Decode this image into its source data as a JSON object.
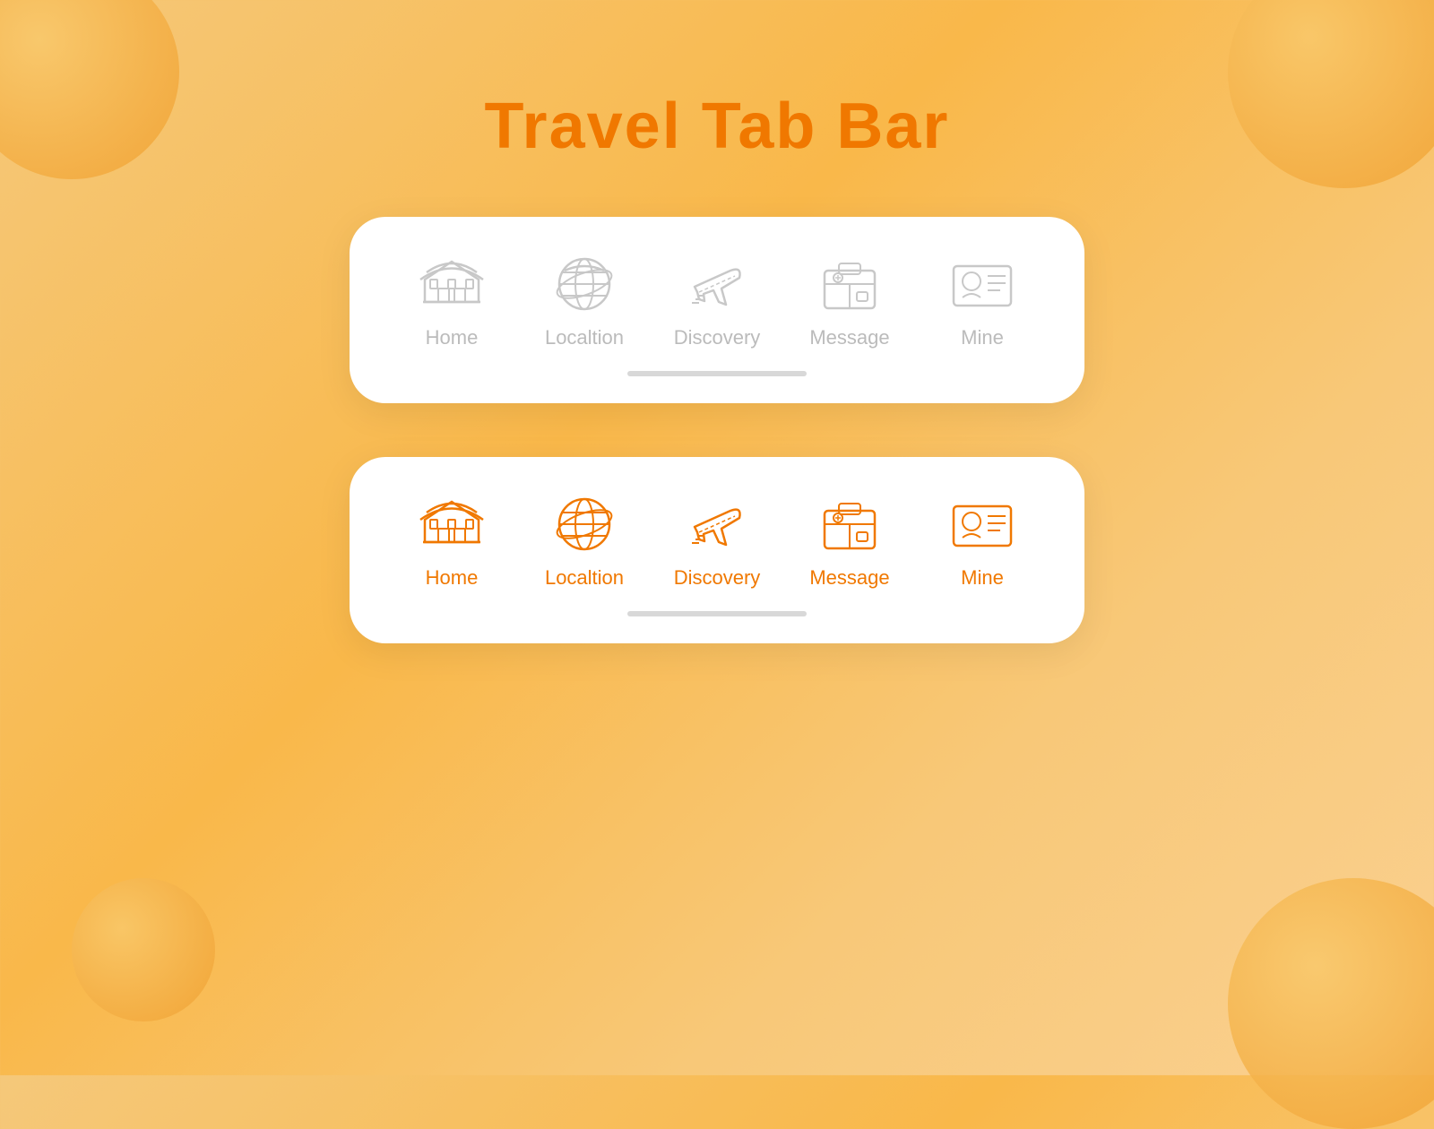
{
  "page": {
    "title": "Travel Tab Bar",
    "title_color": "#f07800"
  },
  "tab_bars": [
    {
      "id": "inactive",
      "style": "inactive",
      "items": [
        {
          "id": "home",
          "label": "Home",
          "active": false
        },
        {
          "id": "location",
          "label": "Localtion",
          "active": false
        },
        {
          "id": "discovery",
          "label": "Discovery",
          "active": false
        },
        {
          "id": "message",
          "label": "Message",
          "active": false
        },
        {
          "id": "mine",
          "label": "Mine",
          "active": false
        }
      ]
    },
    {
      "id": "active",
      "style": "active-style",
      "items": [
        {
          "id": "home",
          "label": "Home",
          "active": true
        },
        {
          "id": "location",
          "label": "Localtion",
          "active": true
        },
        {
          "id": "discovery",
          "label": "Discovery",
          "active": true
        },
        {
          "id": "message",
          "label": "Message",
          "active": true
        },
        {
          "id": "mine",
          "label": "Mine",
          "active": true
        }
      ]
    }
  ]
}
